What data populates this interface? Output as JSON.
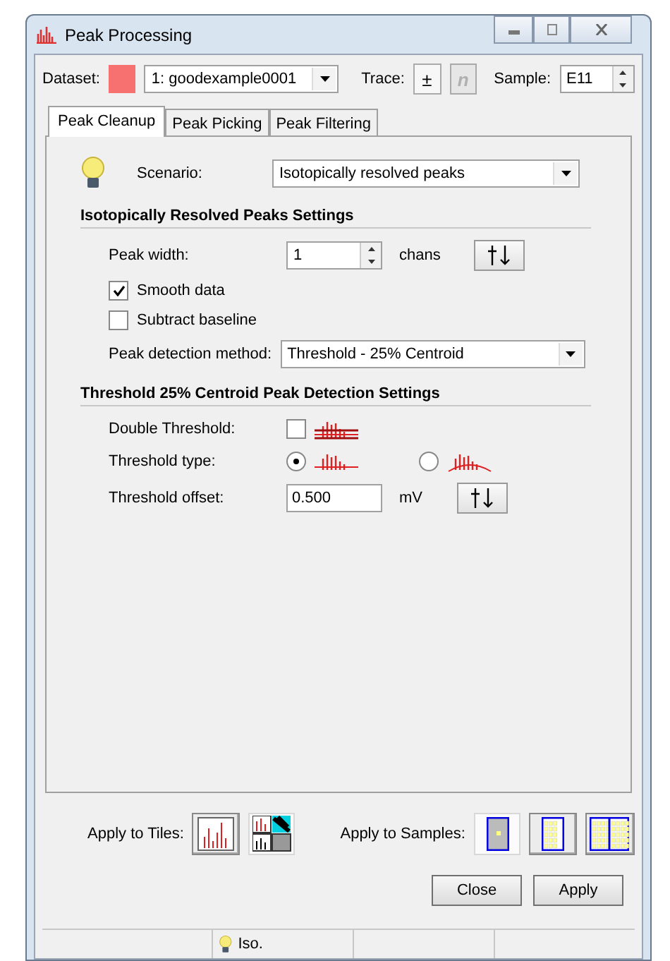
{
  "window": {
    "title": "Peak Processing"
  },
  "dataset": {
    "label": "Dataset:",
    "value": "1: goodexample0001"
  },
  "trace": {
    "label": "Trace:",
    "buttons": [
      {
        "text": "±",
        "disabled": false
      },
      {
        "text": "n",
        "disabled": true
      }
    ]
  },
  "sample": {
    "label": "Sample:",
    "value": "E11"
  },
  "tabs": [
    {
      "label": "Peak Cleanup",
      "selected": true
    },
    {
      "label": "Peak Picking",
      "selected": false
    },
    {
      "label": "Peak Filtering",
      "selected": false
    }
  ],
  "scenario": {
    "label": "Scenario:",
    "value": "Isotopically resolved peaks"
  },
  "sections": [
    {
      "title": "Isotopically Resolved Peaks Settings",
      "rows": [
        {
          "kind": "spin",
          "label": "Peak width:",
          "value": "1",
          "unit": "chans"
        },
        {
          "kind": "checkbox",
          "label": "Smooth data",
          "checked": true
        },
        {
          "kind": "checkbox",
          "label": "Subtract baseline",
          "checked": false
        },
        {
          "kind": "select",
          "label": "Peak detection method:",
          "value": "Threshold - 25% Centroid"
        }
      ]
    },
    {
      "title": "Threshold 25% Centroid Peak Detection Settings",
      "rows": [
        {
          "kind": "iconcheck",
          "label": "Double Threshold:",
          "checked": false
        },
        {
          "kind": "radio",
          "label": "Threshold type:",
          "options": [
            {
              "selected": true
            },
            {
              "selected": false
            }
          ]
        },
        {
          "kind": "field",
          "label": "Threshold offset:",
          "value": "0.500",
          "unit": "mV"
        }
      ]
    }
  ],
  "apply": {
    "tiles_label": "Apply to Tiles:",
    "tiles": [
      {
        "selected": false
      },
      {
        "selected": true
      }
    ],
    "samples_label": "Apply to Samples:",
    "samples": [
      {
        "selected": true
      },
      {
        "selected": false
      },
      {
        "selected": false
      }
    ]
  },
  "buttons": [
    "Close",
    "Apply"
  ],
  "status_bar": {
    "text": "Iso."
  }
}
